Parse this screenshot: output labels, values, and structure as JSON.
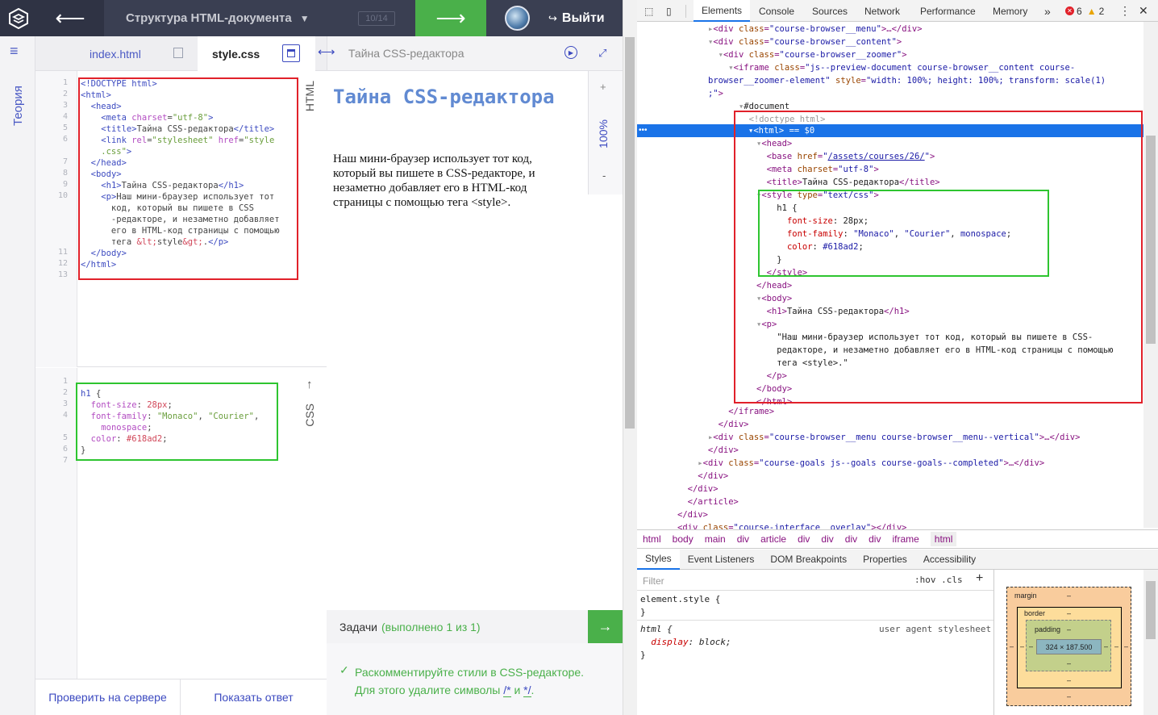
{
  "topbar": {
    "course_title": "Структура HTML-документа",
    "progress": "10/14",
    "prev_arrow": "⟵",
    "next_arrow": "⟶",
    "logout_label": "Выйти",
    "logout_icon": "↪"
  },
  "left_rail": {
    "menu_icon": "≡",
    "theory_label": "Теория"
  },
  "editor": {
    "tabs": [
      {
        "label": "index.html"
      },
      {
        "label": "style.css"
      }
    ],
    "html_label": "HTML",
    "css_label": "CSS",
    "html_line_numbers": [
      "1",
      "2",
      "3",
      "4",
      "5",
      "6",
      "",
      "7",
      "8",
      "9",
      "10",
      "",
      "",
      "",
      "",
      "11",
      "12",
      "13"
    ],
    "css_line_numbers": [
      "1",
      "2",
      "3",
      "4",
      "",
      "5",
      "6",
      "7"
    ]
  },
  "preview": {
    "title": "Тайна CSS-редактора",
    "zoom": "100%",
    "zoom_plus": "+",
    "zoom_minus": "-",
    "h1": "Тайна CSS-редактора",
    "paragraph": "Наш мини-браузер использует тот код, который вы пишете в CSS-редакторе, и незаметно добавляет его в HTML-код страницы с помощью тега <style>.",
    "tasks_label": "Задачи",
    "tasks_done": "(выполнено 1 из 1)",
    "task_text_1": "Раскомментируйте стили в CSS-редакторе.",
    "task_text_2": "Для этого удалите символы",
    "task_sym_1": "/*",
    "task_and": "и",
    "task_sym_2": "*/",
    "task_end": "."
  },
  "buttons": {
    "check": "Проверить на сервере",
    "answer": "Показать ответ"
  },
  "devtools": {
    "tabs": [
      "Elements",
      "Console",
      "Sources",
      "Network",
      "Performance",
      "Memory"
    ],
    "more": "»",
    "errors": "6",
    "warnings": "2",
    "breadcrumbs": [
      "html",
      "body",
      "main",
      "div",
      "article",
      "div",
      "div",
      "div",
      "div",
      "iframe",
      "html"
    ],
    "subtabs": [
      "Styles",
      "Event Listeners",
      "DOM Breakpoints",
      "Properties",
      "Accessibility"
    ],
    "filter_placeholder": "Filter",
    "hov_cls": ":hov  .cls",
    "add": "+",
    "user_agent_label": "user agent stylesheet",
    "box_model": {
      "margin": "margin",
      "border": "border",
      "padding": "padding",
      "dash": "–",
      "content": "324 × 187.500"
    }
  },
  "colors": {
    "accent": "#3c4ac0",
    "green": "#4ab04a",
    "h1": "#618ad2",
    "dark": "#3a3f52"
  }
}
